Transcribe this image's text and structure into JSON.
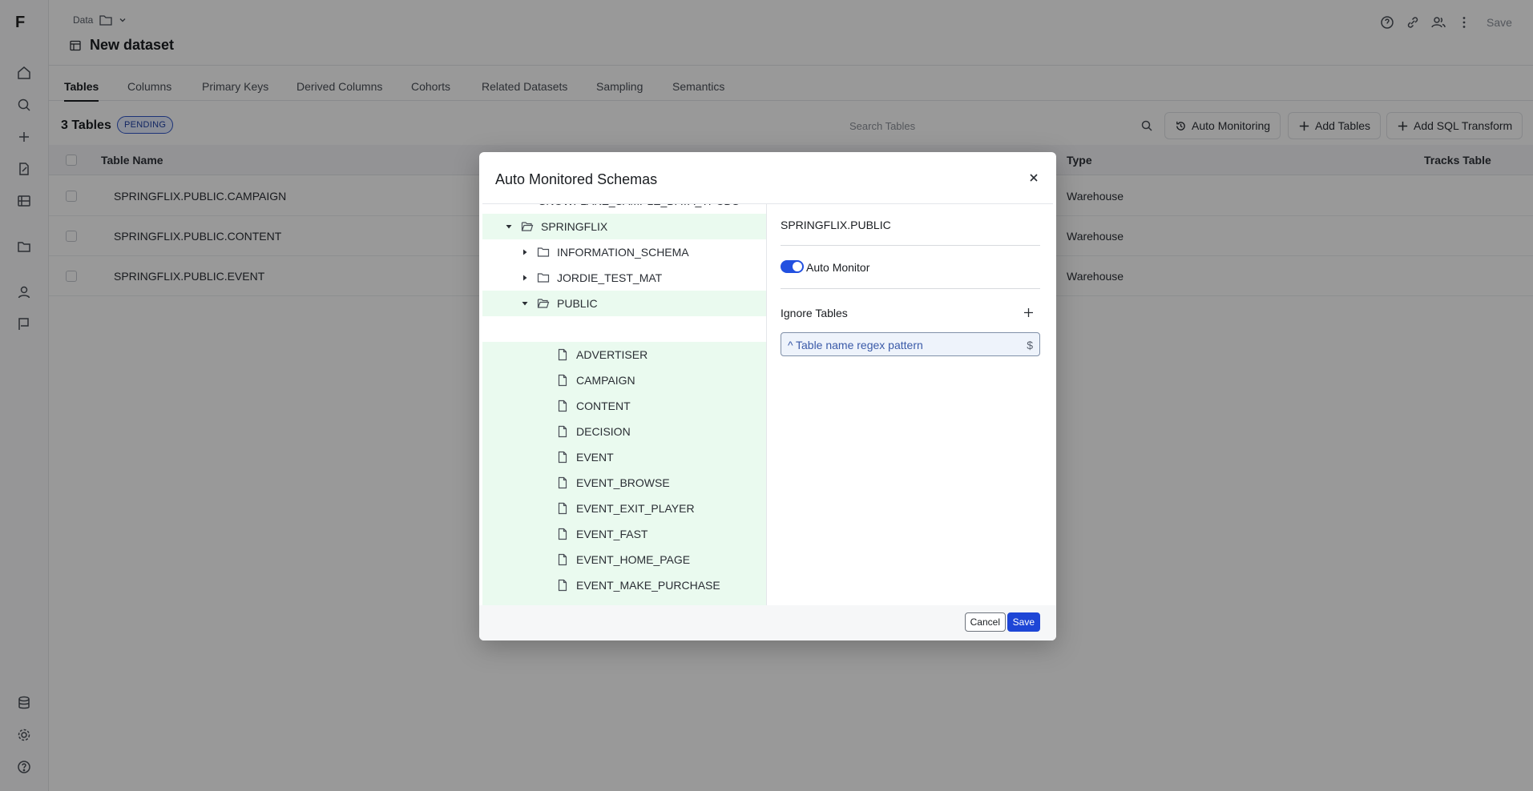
{
  "app": {
    "logo": "F"
  },
  "breadcrumb": {
    "label": "Data"
  },
  "page": {
    "title": "New dataset"
  },
  "header": {
    "save_label": "Save"
  },
  "tabs": [
    {
      "label": "Tables"
    },
    {
      "label": "Columns"
    },
    {
      "label": "Primary Keys"
    },
    {
      "label": "Derived Columns"
    },
    {
      "label": "Cohorts"
    },
    {
      "label": "Related Datasets"
    },
    {
      "label": "Sampling"
    },
    {
      "label": "Semantics"
    }
  ],
  "toolbar": {
    "count_label": "3 Tables",
    "status_badge": "PENDING",
    "search_placeholder": "Search Tables",
    "auto_monitoring_label": "Auto Monitoring",
    "add_tables_label": "Add Tables",
    "add_sql_label": "Add SQL Transform"
  },
  "table": {
    "columns": {
      "name": "Table Name",
      "type": "Type",
      "tracks": "Tracks Table"
    },
    "rows": [
      {
        "name": "SPRINGFLIX.PUBLIC.CAMPAIGN",
        "type": "Warehouse"
      },
      {
        "name": "SPRINGFLIX.PUBLIC.CONTENT",
        "type": "Warehouse"
      },
      {
        "name": "SPRINGFLIX.PUBLIC.EVENT",
        "type": "Warehouse"
      }
    ]
  },
  "modal": {
    "title": "Auto Monitored Schemas",
    "tree": {
      "cut_off_label": "SNOWFLAKE_SAMPLE_DATA_TPCDS",
      "database": "SPRINGFLIX",
      "schemas": [
        "INFORMATION_SCHEMA",
        "JORDIE_TEST_MAT",
        "PUBLIC"
      ],
      "tables": [
        "ADVERTISER",
        "CAMPAIGN",
        "CONTENT",
        "DECISION",
        "EVENT",
        "EVENT_BROWSE",
        "EVENT_EXIT_PLAYER",
        "EVENT_FAST",
        "EVENT_HOME_PAGE",
        "EVENT_MAKE_PURCHASE"
      ]
    },
    "detail": {
      "title": "SPRINGFLIX.PUBLIC",
      "auto_monitor_label": "Auto Monitor",
      "auto_monitor_on": true,
      "ignore_tables_label": "Ignore Tables",
      "regex_prefix": "^",
      "regex_placeholder": "Table name regex pattern",
      "regex_suffix": "$"
    },
    "cancel_label": "Cancel",
    "save_label": "Save"
  },
  "colors": {
    "accent": "#1e46d6",
    "highlight_row": "#eafaef",
    "badge_border": "#2f55c8"
  }
}
